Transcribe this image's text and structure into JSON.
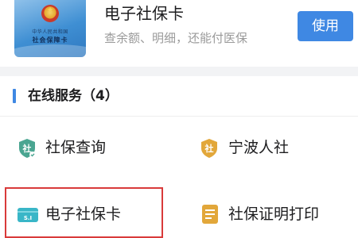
{
  "card": {
    "title": "电子社保卡",
    "subtitle": "查余额、明细，还能付医保",
    "use_button_label": "使用",
    "thumbnail_line1": "中华人民共和国",
    "thumbnail_line2": "社会保障卡"
  },
  "section": {
    "title": "在线服务（4）"
  },
  "services": [
    {
      "label": "社保查询",
      "icon": "social-security-shield-icon",
      "icon_text": "社"
    },
    {
      "label": "宁波人社",
      "icon": "ningbo-hrss-badge-icon",
      "icon_text": "社"
    },
    {
      "label": "电子社保卡",
      "icon": "e-card-icon",
      "icon_text": "S.I"
    },
    {
      "label": "社保证明打印",
      "icon": "document-print-icon",
      "icon_text": ""
    }
  ],
  "colors": {
    "accent": "#3f88e3",
    "icon_green": "#4aa591",
    "icon_gold": "#e2a73a",
    "icon_cyan": "#39b6c7",
    "highlight": "#d93a3a",
    "separator": "#f2f3f5"
  }
}
